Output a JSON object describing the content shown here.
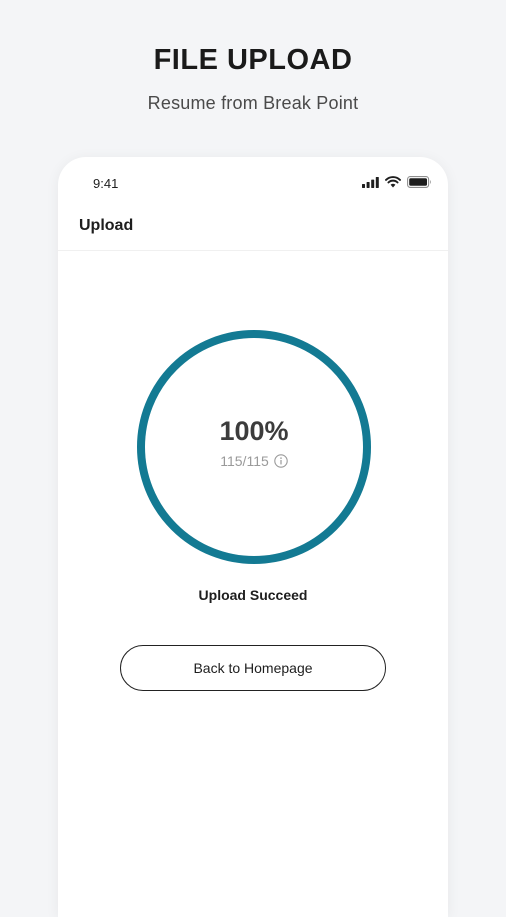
{
  "hero": {
    "title": "FILE UPLOAD",
    "subtitle": "Resume from Break Point"
  },
  "status_bar": {
    "time": "9:41",
    "icons": [
      "signal-icon",
      "wifi-icon",
      "battery-icon"
    ]
  },
  "nav": {
    "title": "Upload"
  },
  "progress": {
    "percent_label": "100%",
    "count_label": "115/115",
    "value": 1.0,
    "color": "#137a93",
    "info_icon": "info-icon"
  },
  "result": {
    "message": "Upload Succeed"
  },
  "actions": {
    "home_button_label": "Back to Homepage"
  }
}
